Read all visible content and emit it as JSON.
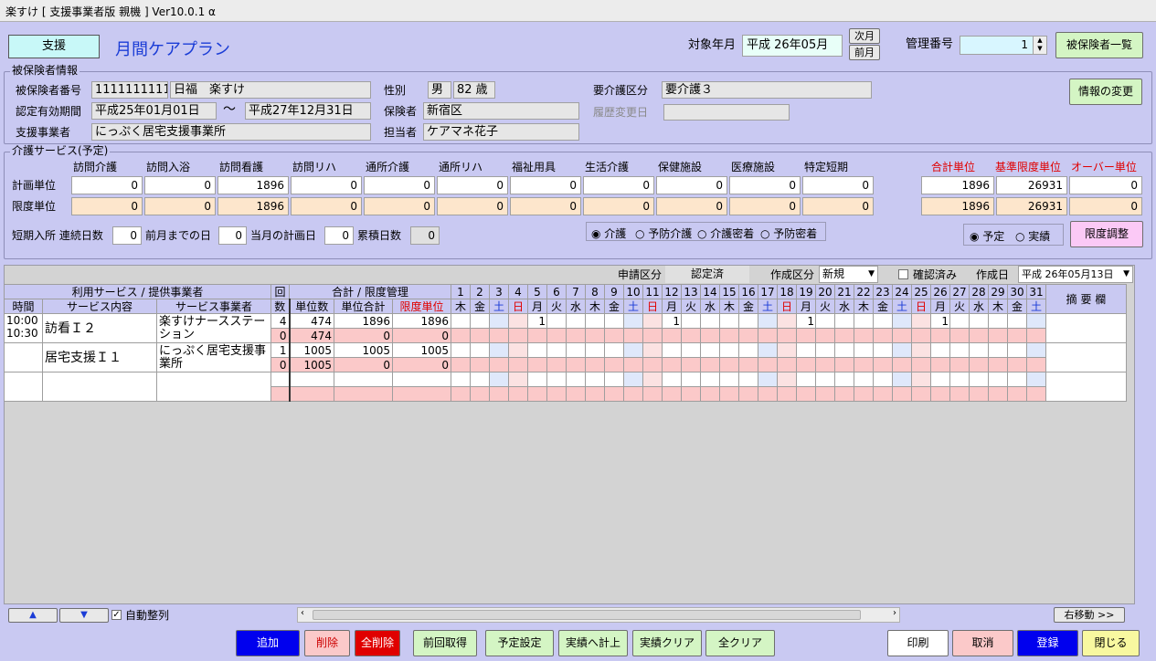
{
  "window": {
    "title": "楽すけ [ 支援事業者版 親機 ] Ver10.0.1 α"
  },
  "header": {
    "mode_badge": "支援",
    "page_title": "月間ケアプラン",
    "target_month_label": "対象年月",
    "target_month_value": "平成 26年05月",
    "next_month": "次月",
    "prev_month": "前月",
    "mgmt_no_label": "管理番号",
    "mgmt_no_value": "1",
    "insured_list_button": "被保険者一覧"
  },
  "insured": {
    "section_title": "被保険者情報",
    "number_label": "被保険者番号",
    "number_value": "1111111111",
    "name_value": "日福　楽すけ",
    "gender_label": "性別",
    "gender_value": "男",
    "age_value": "82 歳",
    "care_level_label": "要介護区分",
    "care_level_value": "要介護３",
    "period_label": "認定有効期間",
    "period_from": "平成25年01月01日",
    "period_sep": "～",
    "period_to": "平成27年12月31日",
    "insurer_label": "保険者",
    "insurer_value": "新宿区",
    "history_label": "履歴変更日",
    "history_value": "",
    "provider_label": "支援事業者",
    "provider_value": "にっぷく居宅支援事業所",
    "manager_label": "担当者",
    "manager_value": "ケアマネ花子",
    "change_info_button": "情報の変更"
  },
  "services": {
    "section_title": "介護サービス(予定)",
    "columns": [
      "訪問介護",
      "訪問入浴",
      "訪問看護",
      "訪問リハ",
      "通所介護",
      "通所リハ",
      "福祉用具",
      "生活介護",
      "保健施設",
      "医療施設",
      "特定短期"
    ],
    "plan_label": "計画単位",
    "limit_label": "限度単位",
    "plan_values": [
      "0",
      "0",
      "1896",
      "0",
      "0",
      "0",
      "0",
      "0",
      "0",
      "0",
      "0"
    ],
    "limit_values": [
      "0",
      "0",
      "1896",
      "0",
      "0",
      "0",
      "0",
      "0",
      "0",
      "0",
      "0"
    ],
    "summary_headers": [
      "合計単位",
      "基準限度単位",
      "オーバー単位"
    ],
    "summary_plan": [
      "1896",
      "26931",
      "0"
    ],
    "summary_limit": [
      "1896",
      "26931",
      "0"
    ],
    "short_stay_label": "短期入所 連続日数",
    "short_stay_value": "0",
    "prev_month_days_label": "前月までの日",
    "prev_month_days_value": "0",
    "this_month_plan_label": "当月の計画日",
    "this_month_plan_value": "0",
    "cumulative_label": "累積日数",
    "cumulative_value": "0",
    "radio_types": [
      "介護",
      "予防介護",
      "介護密着",
      "予防密着"
    ],
    "radio_plan": [
      "予定",
      "実績"
    ],
    "limit_adjust_button": "限度調整"
  },
  "schedule": {
    "apply_label": "申請区分",
    "apply_value": "認定済",
    "create_type_label": "作成区分",
    "create_type_value": "新規",
    "confirmed_label": "確認済み",
    "create_date_label": "作成日",
    "create_date_value": "平成 26年05月13日",
    "hdr_service_group": "利用サービス / 提供事業者",
    "hdr_time": "時間",
    "hdr_content": "サービス内容",
    "hdr_provider": "サービス事業者",
    "hdr_count_top": "回",
    "hdr_count_bottom": "数",
    "hdr_total_group": "合計 / 限度管理",
    "hdr_unit": "単位数",
    "hdr_unit_total": "単位合計",
    "hdr_limit": "限度単位",
    "hdr_memo": "摘 要 欄",
    "days": [
      "1",
      "2",
      "3",
      "4",
      "5",
      "6",
      "7",
      "8",
      "9",
      "10",
      "11",
      "12",
      "13",
      "14",
      "15",
      "16",
      "17",
      "18",
      "19",
      "20",
      "21",
      "22",
      "23",
      "24",
      "25",
      "26",
      "27",
      "28",
      "29",
      "30",
      "31"
    ],
    "weekdays": [
      "木",
      "金",
      "土",
      "日",
      "月",
      "火",
      "水",
      "木",
      "金",
      "土",
      "日",
      "月",
      "火",
      "水",
      "木",
      "金",
      "土",
      "日",
      "月",
      "火",
      "水",
      "木",
      "金",
      "土",
      "日",
      "月",
      "火",
      "水",
      "木",
      "金",
      "土"
    ],
    "rows": [
      {
        "time1": "10:00",
        "time2": "10:30",
        "content": "訪看Ｉ２",
        "provider": "楽すけナースステーション",
        "count": "4",
        "unit": "474",
        "unit_total": "1896",
        "limit": "1896",
        "count2": "0",
        "unit2": "474",
        "unit_total2": "0",
        "limit2": "0",
        "marks": {
          "5": "1",
          "12": "1",
          "19": "1",
          "26": "1"
        }
      },
      {
        "time1": "",
        "time2": "",
        "content": "居宅支援Ｉ１",
        "provider": "にっぷく居宅支援事業所",
        "count": "1",
        "unit": "1005",
        "unit_total": "1005",
        "limit": "1005",
        "count2": "0",
        "unit2": "1005",
        "unit_total2": "0",
        "limit2": "0",
        "marks": {}
      }
    ],
    "auto_sort_label": "自動整列",
    "scroll_right_button": "右移動 >>"
  },
  "footer": {
    "add": "追加",
    "delete": "削除",
    "delete_all": "全削除",
    "prev_fetch": "前回取得",
    "plan_set": "予定設定",
    "to_actual": "実績へ計上",
    "actual_clear": "実績クリア",
    "all_clear": "全クリア",
    "print": "印刷",
    "cancel": "取消",
    "register": "登録",
    "close": "閉じる"
  }
}
